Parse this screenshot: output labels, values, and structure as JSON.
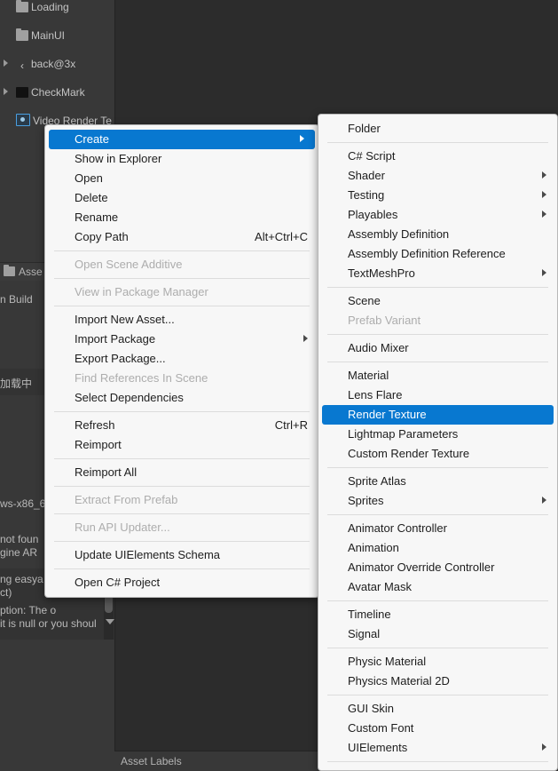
{
  "app": {
    "theme_bg": "#2c2c2c",
    "accent": "#0878d0"
  },
  "hierarchy": {
    "items": [
      {
        "label": "Loading",
        "icon": "folder-icon",
        "foldout": false
      },
      {
        "label": "MainUI",
        "icon": "folder-icon",
        "foldout": false
      },
      {
        "label": "back@3x",
        "icon": "sprite-back-icon",
        "foldout": true
      },
      {
        "label": "CheckMark",
        "icon": "texture-black-icon",
        "foldout": true
      },
      {
        "label": "Video Render Te",
        "icon": "render-texture-icon",
        "foldout": false
      }
    ]
  },
  "breadcrumb": {
    "label": "Asse"
  },
  "console": {
    "lines": [
      "n Build",
      "加载中",
      "ws-x86_6",
      " not foun",
      "gine AR",
      "ng easya",
      "ct)",
      "ption: The o",
      "it is null or you shoul"
    ]
  },
  "status_bar": {
    "asset_labels": "Asset Labels"
  },
  "context_menu": {
    "title": "project-context-menu",
    "items": [
      {
        "label": "Create",
        "selected": true,
        "submenu": true,
        "shortcut": "",
        "disabled": false
      },
      {
        "label": "Show in Explorer",
        "selected": false,
        "submenu": false,
        "shortcut": "",
        "disabled": false
      },
      {
        "label": "Open",
        "selected": false,
        "submenu": false,
        "shortcut": "",
        "disabled": false
      },
      {
        "label": "Delete",
        "selected": false,
        "submenu": false,
        "shortcut": "",
        "disabled": false
      },
      {
        "label": "Rename",
        "selected": false,
        "submenu": false,
        "shortcut": "",
        "disabled": false
      },
      {
        "label": "Copy Path",
        "selected": false,
        "submenu": false,
        "shortcut": "Alt+Ctrl+C",
        "disabled": false
      },
      {
        "separator": true
      },
      {
        "label": "Open Scene Additive",
        "selected": false,
        "submenu": false,
        "shortcut": "",
        "disabled": true
      },
      {
        "separator": true
      },
      {
        "label": "View in Package Manager",
        "selected": false,
        "submenu": false,
        "shortcut": "",
        "disabled": true
      },
      {
        "separator": true
      },
      {
        "label": "Import New Asset...",
        "selected": false,
        "submenu": false,
        "shortcut": "",
        "disabled": false
      },
      {
        "label": "Import Package",
        "selected": false,
        "submenu": true,
        "shortcut": "",
        "disabled": false
      },
      {
        "label": "Export Package...",
        "selected": false,
        "submenu": false,
        "shortcut": "",
        "disabled": false
      },
      {
        "label": "Find References In Scene",
        "selected": false,
        "submenu": false,
        "shortcut": "",
        "disabled": true
      },
      {
        "label": "Select Dependencies",
        "selected": false,
        "submenu": false,
        "shortcut": "",
        "disabled": false
      },
      {
        "separator": true
      },
      {
        "label": "Refresh",
        "selected": false,
        "submenu": false,
        "shortcut": "Ctrl+R",
        "disabled": false
      },
      {
        "label": "Reimport",
        "selected": false,
        "submenu": false,
        "shortcut": "",
        "disabled": false
      },
      {
        "separator": true
      },
      {
        "label": "Reimport All",
        "selected": false,
        "submenu": false,
        "shortcut": "",
        "disabled": false
      },
      {
        "separator": true
      },
      {
        "label": "Extract From Prefab",
        "selected": false,
        "submenu": false,
        "shortcut": "",
        "disabled": true
      },
      {
        "separator": true
      },
      {
        "label": "Run API Updater...",
        "selected": false,
        "submenu": false,
        "shortcut": "",
        "disabled": true
      },
      {
        "separator": true
      },
      {
        "label": "Update UIElements Schema",
        "selected": false,
        "submenu": false,
        "shortcut": "",
        "disabled": false
      },
      {
        "separator": true
      },
      {
        "label": "Open C# Project",
        "selected": false,
        "submenu": false,
        "shortcut": "",
        "disabled": false
      }
    ]
  },
  "create_submenu": {
    "title": "create-submenu",
    "items": [
      {
        "label": "Folder",
        "selected": false,
        "submenu": false,
        "disabled": false
      },
      {
        "separator": true
      },
      {
        "label": "C# Script",
        "selected": false,
        "submenu": false,
        "disabled": false
      },
      {
        "label": "Shader",
        "selected": false,
        "submenu": true,
        "disabled": false
      },
      {
        "label": "Testing",
        "selected": false,
        "submenu": true,
        "disabled": false
      },
      {
        "label": "Playables",
        "selected": false,
        "submenu": true,
        "disabled": false
      },
      {
        "label": "Assembly Definition",
        "selected": false,
        "submenu": false,
        "disabled": false
      },
      {
        "label": "Assembly Definition Reference",
        "selected": false,
        "submenu": false,
        "disabled": false
      },
      {
        "label": "TextMeshPro",
        "selected": false,
        "submenu": true,
        "disabled": false
      },
      {
        "separator": true
      },
      {
        "label": "Scene",
        "selected": false,
        "submenu": false,
        "disabled": false
      },
      {
        "label": "Prefab Variant",
        "selected": false,
        "submenu": false,
        "disabled": true
      },
      {
        "separator": true
      },
      {
        "label": "Audio Mixer",
        "selected": false,
        "submenu": false,
        "disabled": false
      },
      {
        "separator": true
      },
      {
        "label": "Material",
        "selected": false,
        "submenu": false,
        "disabled": false
      },
      {
        "label": "Lens Flare",
        "selected": false,
        "submenu": false,
        "disabled": false
      },
      {
        "label": "Render Texture",
        "selected": true,
        "submenu": false,
        "disabled": false
      },
      {
        "label": "Lightmap Parameters",
        "selected": false,
        "submenu": false,
        "disabled": false
      },
      {
        "label": "Custom Render Texture",
        "selected": false,
        "submenu": false,
        "disabled": false
      },
      {
        "separator": true
      },
      {
        "label": "Sprite Atlas",
        "selected": false,
        "submenu": false,
        "disabled": false
      },
      {
        "label": "Sprites",
        "selected": false,
        "submenu": true,
        "disabled": false
      },
      {
        "separator": true
      },
      {
        "label": "Animator Controller",
        "selected": false,
        "submenu": false,
        "disabled": false
      },
      {
        "label": "Animation",
        "selected": false,
        "submenu": false,
        "disabled": false
      },
      {
        "label": "Animator Override Controller",
        "selected": false,
        "submenu": false,
        "disabled": false
      },
      {
        "label": "Avatar Mask",
        "selected": false,
        "submenu": false,
        "disabled": false
      },
      {
        "separator": true
      },
      {
        "label": "Timeline",
        "selected": false,
        "submenu": false,
        "disabled": false
      },
      {
        "label": "Signal",
        "selected": false,
        "submenu": false,
        "disabled": false
      },
      {
        "separator": true
      },
      {
        "label": "Physic Material",
        "selected": false,
        "submenu": false,
        "disabled": false
      },
      {
        "label": "Physics Material 2D",
        "selected": false,
        "submenu": false,
        "disabled": false
      },
      {
        "separator": true
      },
      {
        "label": "GUI Skin",
        "selected": false,
        "submenu": false,
        "disabled": false
      },
      {
        "label": "Custom Font",
        "selected": false,
        "submenu": false,
        "disabled": false
      },
      {
        "label": "UIElements",
        "selected": false,
        "submenu": true,
        "disabled": false
      },
      {
        "separator": true
      }
    ]
  }
}
